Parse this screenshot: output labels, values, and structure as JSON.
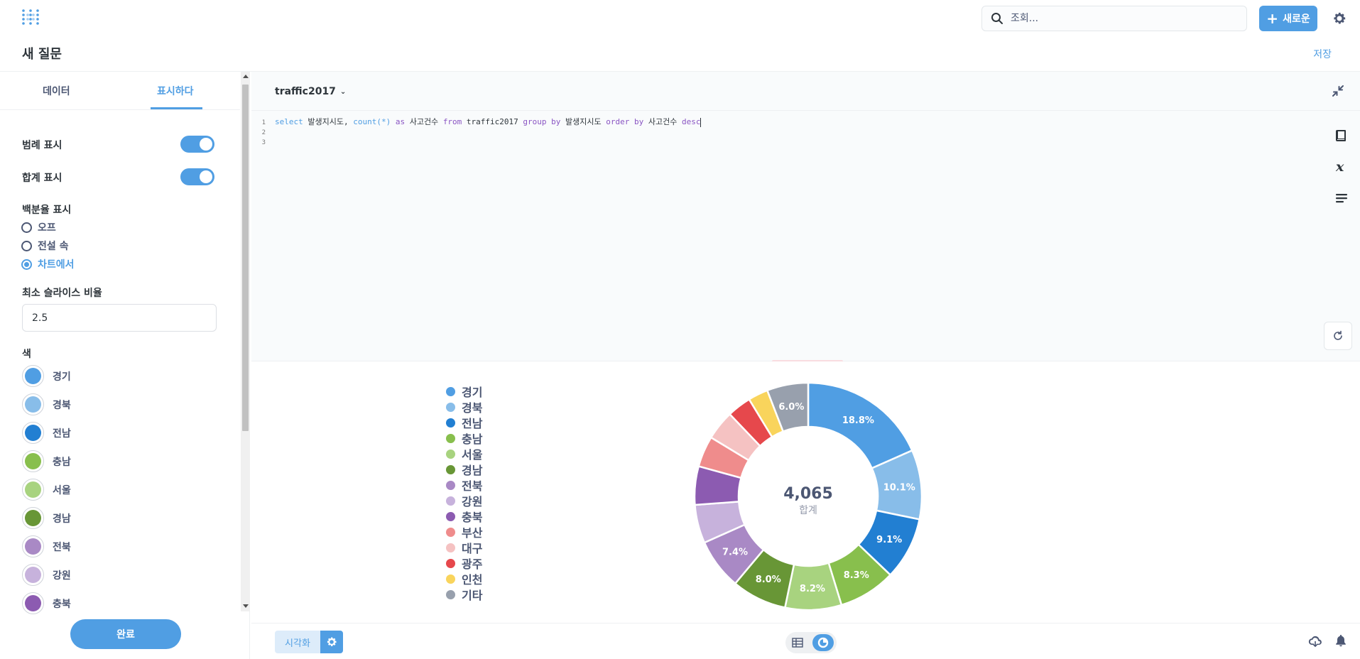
{
  "header": {
    "search_placeholder": "조회...",
    "new_button_label": "새로운"
  },
  "title_bar": {
    "page_title": "새 질문",
    "save_label": "저장"
  },
  "left_panel": {
    "tabs": [
      {
        "label": "데이터",
        "active": false
      },
      {
        "label": "표시하다",
        "active": true
      }
    ],
    "show_legend_label": "범례 표시",
    "show_legend_on": true,
    "show_total_label": "합계 표시",
    "show_total_on": true,
    "percent_label": "백분율 표시",
    "percent_options": [
      {
        "label": "오프",
        "selected": false
      },
      {
        "label": "전설 속",
        "selected": false
      },
      {
        "label": "차트에서",
        "selected": true
      }
    ],
    "min_slice_label": "최소 슬라이스 비율",
    "min_slice_value": "2.5",
    "colors_label": "색",
    "colors": [
      {
        "name": "경기",
        "color": "#509ee3"
      },
      {
        "name": "경북",
        "color": "#88bde9"
      },
      {
        "name": "전남",
        "color": "#227fd2"
      },
      {
        "name": "충남",
        "color": "#88bf4d"
      },
      {
        "name": "서울",
        "color": "#a8d37f"
      },
      {
        "name": "경남",
        "color": "#689636"
      },
      {
        "name": "전북",
        "color": "#a989c5"
      },
      {
        "name": "강원",
        "color": "#c7b2dc"
      },
      {
        "name": "충북",
        "color": "#8c5bb1"
      }
    ],
    "done_label": "완료"
  },
  "editor": {
    "database": "traffic2017",
    "line_numbers": [
      "1",
      "2",
      "3"
    ],
    "sql": {
      "select_kw": "select",
      "col1": " 발생지시도, ",
      "count_fn": "count(*)",
      "as_kw": " as",
      "alias": " 사고건수 ",
      "from_kw": "from",
      "table": " traffic2017 ",
      "groupby_kw": "group by",
      "group_col": " 발생지시도 ",
      "orderby_kw": "order by",
      "order_col": " 사고건수 ",
      "desc_kw": "desc"
    }
  },
  "chart_data": {
    "type": "pie",
    "style": "donut",
    "center_value": "4,065",
    "center_label": "합계",
    "legend_placement": "left",
    "slices": [
      {
        "name": "경기",
        "percent": 18.8,
        "label": "18.8%",
        "color": "#509ee3"
      },
      {
        "name": "경북",
        "percent": 10.1,
        "label": "10.1%",
        "color": "#88bde9"
      },
      {
        "name": "전남",
        "percent": 9.1,
        "label": "9.1%",
        "color": "#227fd2"
      },
      {
        "name": "충남",
        "percent": 8.3,
        "label": "8.3%",
        "color": "#88bf4d"
      },
      {
        "name": "서울",
        "percent": 8.2,
        "label": "8.2%",
        "color": "#a8d37f"
      },
      {
        "name": "경남",
        "percent": 8.0,
        "label": "8.0%",
        "color": "#689636"
      },
      {
        "name": "전북",
        "percent": 7.4,
        "label": "7.4%",
        "color": "#a989c5"
      },
      {
        "name": "강원",
        "percent": 5.6,
        "label": "",
        "color": "#c7b2dc"
      },
      {
        "name": "충북",
        "percent": 5.6,
        "label": "",
        "color": "#8c5bb1"
      },
      {
        "name": "부산",
        "percent": 4.5,
        "label": "",
        "color": "#ef8c8c"
      },
      {
        "name": "대구",
        "percent": 4.3,
        "label": "",
        "color": "#f5c2c2"
      },
      {
        "name": "광주",
        "percent": 3.5,
        "label": "",
        "color": "#e6484c"
      },
      {
        "name": "인천",
        "percent": 2.9,
        "label": "",
        "color": "#f9d45c"
      },
      {
        "name": "기타",
        "percent": 6.0,
        "label": "6.0%",
        "color": "#98a0ad"
      }
    ]
  },
  "footer": {
    "visualization_label": "시각화"
  }
}
